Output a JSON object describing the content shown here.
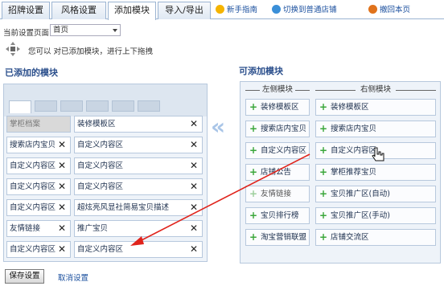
{
  "tabs": [
    {
      "label": "招牌设置",
      "active": false
    },
    {
      "label": "风格设置",
      "active": false
    },
    {
      "label": "添加模块",
      "active": true
    },
    {
      "label": "导入/导出",
      "active": false
    }
  ],
  "toplinks": {
    "guide": "新手指南",
    "switch": "切换到普通店铺",
    "undo": "撤回本页"
  },
  "page_select": {
    "label": "当前设置页面：",
    "value": "首页"
  },
  "hint": "您可以 对已添加模块，进行上下拖拽",
  "left": {
    "title": "已添加的模块",
    "modules": [
      {
        "label": "掌柜档案",
        "locked": true,
        "removable": false
      },
      {
        "label": "装修模板区",
        "locked": false,
        "removable": true
      },
      {
        "label": "搜索店内宝贝",
        "locked": false,
        "removable": true
      },
      {
        "label": "自定义内容区",
        "locked": false,
        "removable": true
      },
      {
        "label": "自定义内容区",
        "locked": false,
        "removable": true
      },
      {
        "label": "自定义内容区",
        "locked": false,
        "removable": true
      },
      {
        "label": "自定义内容区",
        "locked": false,
        "removable": true
      },
      {
        "label": "自定义内容区",
        "locked": false,
        "removable": true
      },
      {
        "label": "自定义内容区",
        "locked": false,
        "removable": true
      },
      {
        "label": "超炫亮风显社简易宝贝描述",
        "locked": false,
        "removable": true
      },
      {
        "label": "友情链接",
        "locked": false,
        "removable": true
      },
      {
        "label": "推广宝贝",
        "locked": false,
        "removable": true
      },
      {
        "label": "自定义内容区",
        "locked": false,
        "removable": true
      },
      {
        "label": "自定义内容区",
        "locked": false,
        "removable": true
      }
    ],
    "close_glyph": "✕"
  },
  "right": {
    "title": "可添加模块",
    "left_col_title": "左侧模块",
    "right_col_title": "右侧模块",
    "left_col": [
      {
        "label": "装修模板区",
        "enabled": true
      },
      {
        "label": "搜索店内宝贝",
        "enabled": true
      },
      {
        "label": "自定义内容区",
        "enabled": true
      },
      {
        "label": "店铺公告",
        "enabled": true
      },
      {
        "label": "友情链接",
        "enabled": false
      },
      {
        "label": "宝贝排行榜",
        "enabled": true
      },
      {
        "label": "淘宝营销联盟",
        "enabled": true
      }
    ],
    "right_col": [
      {
        "label": "装修模板区",
        "enabled": true
      },
      {
        "label": "搜索店内宝贝",
        "enabled": true
      },
      {
        "label": "自定义内容区",
        "enabled": true
      },
      {
        "label": "掌柜推荐宝贝",
        "enabled": true
      },
      {
        "label": "宝贝推广区(自动)",
        "enabled": true
      },
      {
        "label": "宝贝推广区(手动)",
        "enabled": true
      },
      {
        "label": "店铺交流区",
        "enabled": true
      }
    ],
    "plus_glyph": "+"
  },
  "arrow_glyph": "«",
  "buttons": {
    "save": "保存设置",
    "cancel": "取消设置"
  },
  "colors": {
    "accent": "#2b4f8c",
    "link": "#1a4f9e",
    "arrow": "#e0231b",
    "plus": "#3aa63a"
  }
}
